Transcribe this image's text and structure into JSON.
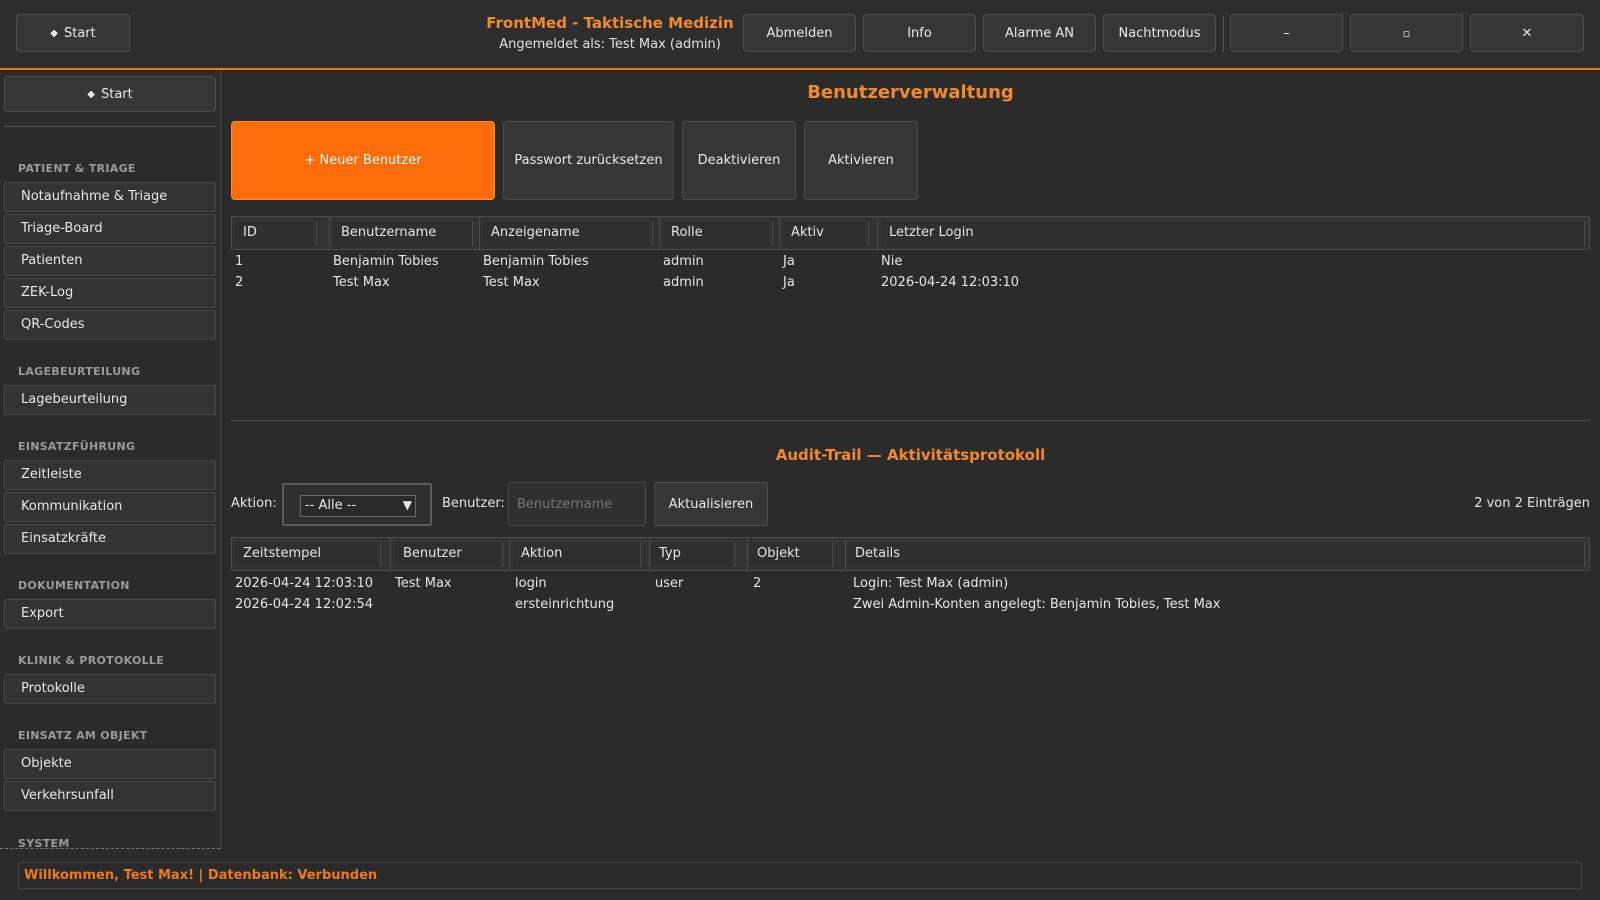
{
  "app": {
    "title": "FrontMed - Taktische Medizin",
    "subtitle": "Angemeldet als: Test Max (admin)"
  },
  "topbar": {
    "start_label": "Start",
    "logout_label": "Abmelden",
    "info_label": "Info",
    "alarms_label": "Alarme AN",
    "night_label": "Nachtmodus",
    "minimize_label": "–",
    "maximize_label": "▫",
    "close_label": "✕"
  },
  "sidebar": {
    "start_label": "Start",
    "sections": [
      {
        "title": "PATIENT & TRIAGE",
        "items": [
          "Notaufnahme & Triage",
          "Triage-Board",
          "Patienten",
          "ZEK-Log",
          "QR-Codes"
        ]
      },
      {
        "title": "LAGEBEURTEILUNG",
        "items": [
          "Lagebeurteilung"
        ]
      },
      {
        "title": "EINSATZFÜHRUNG",
        "items": [
          "Zeitleiste",
          "Kommunikation",
          "Einsatzkräfte"
        ]
      },
      {
        "title": "DOKUMENTATION",
        "items": [
          "Export"
        ]
      },
      {
        "title": "KLINIK & PROTOKOLLE",
        "items": [
          "Protokolle"
        ]
      },
      {
        "title": "EINSATZ AM OBJEKT",
        "items": [
          "Objekte",
          "Verkehrsunfall"
        ]
      },
      {
        "title": "SYSTEM",
        "items": []
      }
    ]
  },
  "users": {
    "title": "Benutzerverwaltung",
    "new_user_label": "+ Neuer Benutzer",
    "reset_password_label": "Passwort zurücksetzen",
    "deactivate_label": "Deaktivieren",
    "activate_label": "Aktivieren",
    "columns": [
      "ID",
      "Benutzername",
      "Anzeigename",
      "Rolle",
      "Aktiv",
      "Letzter Login"
    ],
    "rows": [
      [
        "1",
        "Benjamin Tobies",
        "Benjamin Tobies",
        "admin",
        "Ja",
        "Nie"
      ],
      [
        "2",
        "Test Max",
        "Test Max",
        "admin",
        "Ja",
        "2026-04-24 12:03:10"
      ]
    ]
  },
  "audit": {
    "title": "Audit-Trail — Aktivitätsprotokoll",
    "action_label": "Aktion:",
    "action_value": "-- Alle --",
    "user_label": "Benutzer:",
    "user_placeholder": "Benutzername",
    "refresh_label": "Aktualisieren",
    "count_text": "2 von 2 Einträgen",
    "columns": [
      "Zeitstempel",
      "Benutzer",
      "Aktion",
      "Typ",
      "Objekt",
      "Details"
    ],
    "rows": [
      [
        "2026-04-24 12:03:10",
        "Test Max",
        "login",
        "user",
        "2",
        "Login: Test Max (admin)"
      ],
      [
        "2026-04-24 12:02:54",
        "",
        "ersteinrichtung",
        "",
        "",
        "Zwei Admin-Konten angelegt: Benjamin Tobies, Test Max"
      ]
    ]
  },
  "status": {
    "text": "Willkommen, Test Max! | Datenbank: Verbunden"
  },
  "colors": {
    "accent": "#f07a1a",
    "background": "#2b2b2b"
  }
}
